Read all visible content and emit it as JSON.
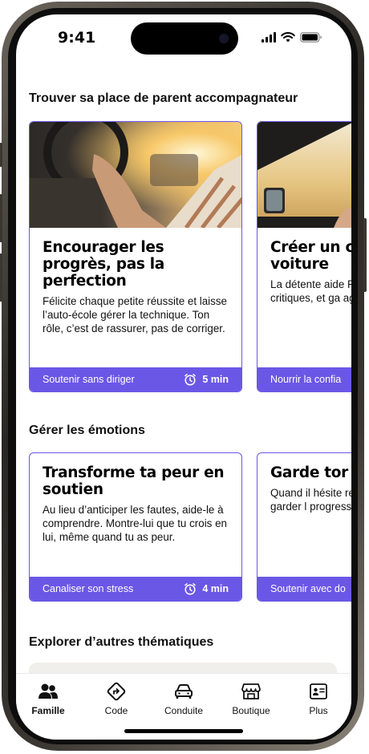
{
  "status": {
    "time": "9:41"
  },
  "sections": [
    {
      "title": "Trouver sa place de parent accompagnateur",
      "cards": [
        {
          "title": "Encourager les progrès, pas la perfection",
          "text": "Félicite chaque petite réussite et laisse l’auto-école gérer la technique. Ton rôle, c’est de rassurer, pas de corriger.",
          "tag": "Soutenir sans diriger",
          "duration": "5 min"
        },
        {
          "title": "Créer un confiance voiture",
          "text": "La détente aide Parle calmeme critiques, et ga agréables.",
          "tag": "Nourrir la confia"
        }
      ]
    },
    {
      "title": "Gérer les émotions",
      "cards": [
        {
          "title": "Transforme ta peur en soutien",
          "text": "Au lieu d’anticiper les fautes, aide-le à comprendre. Montre-lui que tu crois en lui, même quand tu as peur.",
          "tag": "Canaliser son stress",
          "duration": "4 min"
        },
        {
          "title": "Garde tor toutes sit",
          "text": "Quand il hésite respire avant d l’aide à garder l progresser.",
          "tag": "Soutenir avec do"
        }
      ]
    },
    {
      "title": "Explorer d’autres thématiques"
    }
  ],
  "tabs": [
    {
      "label": "Famille",
      "icon": "family-icon",
      "active": true
    },
    {
      "label": "Code",
      "icon": "road-sign-icon"
    },
    {
      "label": "Conduite",
      "icon": "car-icon"
    },
    {
      "label": "Boutique",
      "icon": "shop-icon"
    },
    {
      "label": "Plus",
      "icon": "profile-card-icon"
    }
  ],
  "colors": {
    "accent": "#6a57e6",
    "text": "#111111",
    "background": "#ffffff"
  }
}
